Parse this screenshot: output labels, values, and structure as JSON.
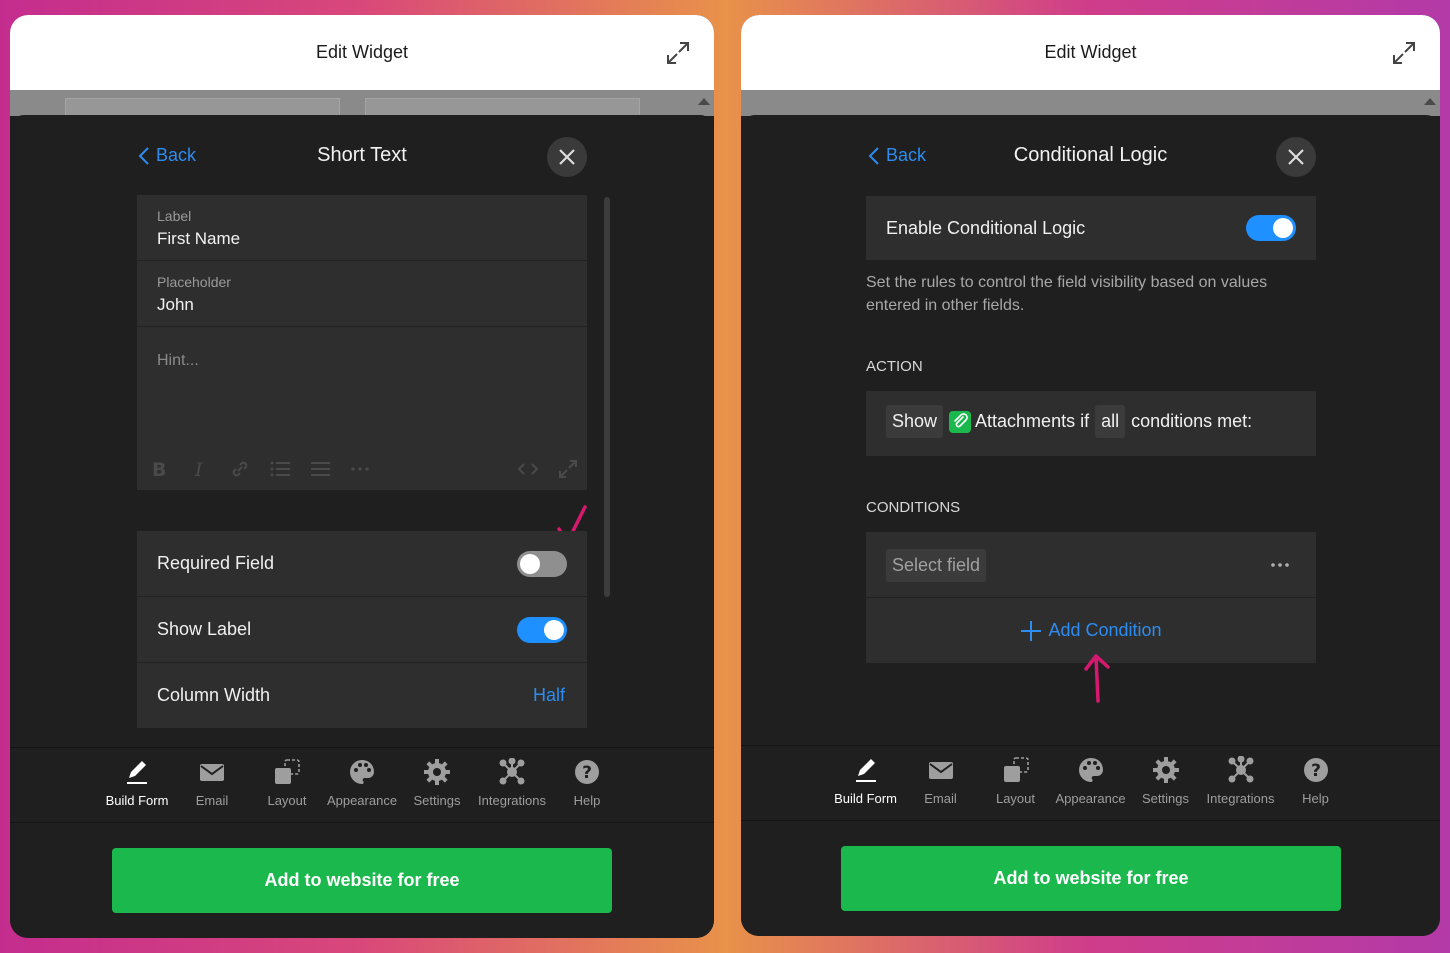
{
  "colors": {
    "accent": "#2d8cf0",
    "toggle_on": "#1e90ff",
    "cta": "#1bb84e",
    "annotation": "#d6196f"
  },
  "left": {
    "window_title": "Edit Widget",
    "back_label": "Back",
    "panel_title": "Short Text",
    "fields": {
      "label_title": "Label",
      "label_value": "First Name",
      "placeholder_title": "Placeholder",
      "placeholder_value": "John",
      "hint_placeholder": "Hint..."
    },
    "toggles": {
      "required_label": "Required Field",
      "required_on": false,
      "show_label_label": "Show Label",
      "show_label_on": true,
      "column_width_label": "Column Width",
      "column_width_value": "Half"
    },
    "cta": "Add to website for free"
  },
  "right": {
    "window_title": "Edit Widget",
    "back_label": "Back",
    "panel_title": "Conditional Logic",
    "enable_label": "Enable Conditional Logic",
    "enable_on": true,
    "description": "Set the rules to control the field visibility based on values entered in other fields.",
    "action_heading": "ACTION",
    "action": {
      "verb": "Show",
      "field": "Attachments if",
      "quantifier": "all",
      "suffix": "conditions met:"
    },
    "conditions_heading": "CONDITIONS",
    "select_field": "Select field",
    "add_condition": "Add Condition",
    "cta": "Add to website for free"
  },
  "nav": [
    {
      "label": "Build Form",
      "icon": "pencil-icon",
      "active": true
    },
    {
      "label": "Email",
      "icon": "envelope-icon",
      "active": false
    },
    {
      "label": "Layout",
      "icon": "layout-icon",
      "active": false
    },
    {
      "label": "Appearance",
      "icon": "palette-icon",
      "active": false
    },
    {
      "label": "Settings",
      "icon": "gear-icon",
      "active": false
    },
    {
      "label": "Integrations",
      "icon": "integrations-icon",
      "active": false
    },
    {
      "label": "Help",
      "icon": "help-icon",
      "active": false
    }
  ]
}
